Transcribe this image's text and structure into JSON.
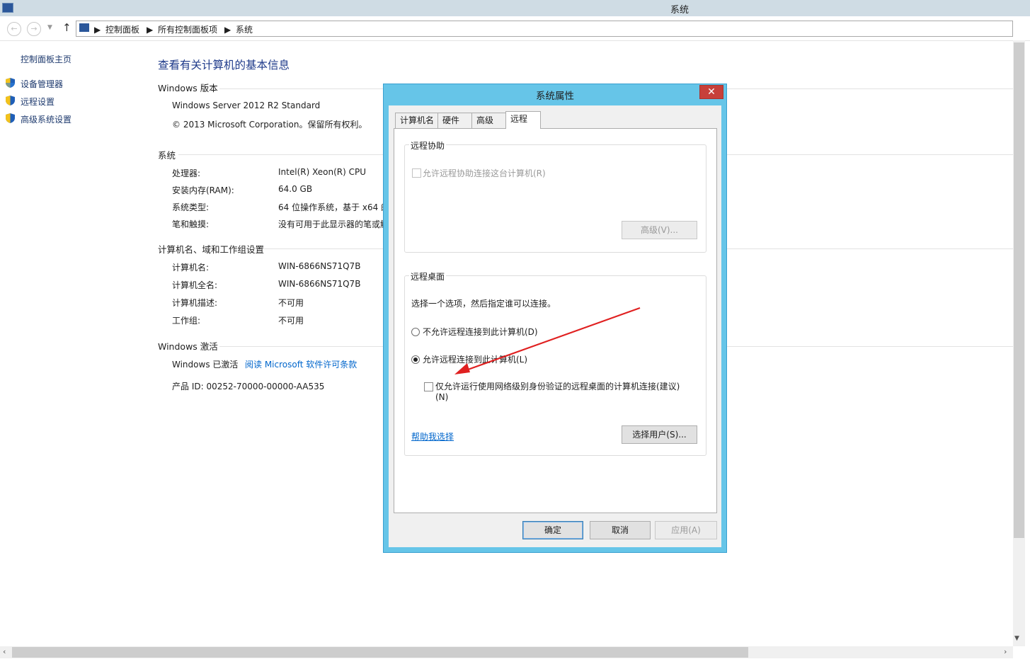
{
  "window": {
    "title": "系统"
  },
  "address": {
    "crumbs": [
      "控制面板",
      "所有控制面板项",
      "系统"
    ]
  },
  "sidebar": {
    "home": "控制面板主页",
    "links": [
      "设备管理器",
      "远程设置",
      "高级系统设置"
    ]
  },
  "main": {
    "heading": "查看有关计算机的基本信息",
    "windows_edition": {
      "title": "Windows 版本",
      "edition": "Windows Server 2012 R2 Standard",
      "copyright": "© 2013 Microsoft Corporation。保留所有权利。"
    },
    "system": {
      "title": "系统",
      "rows": [
        {
          "label": "处理器:",
          "value": "Intel(R) Xeon(R) CPU"
        },
        {
          "label": "安装内存(RAM):",
          "value": "64.0 GB"
        },
        {
          "label": "系统类型:",
          "value": "64 位操作系统，基于 x64 的"
        },
        {
          "label": "笔和触摸:",
          "value": "没有可用于此显示器的笔或触"
        }
      ]
    },
    "computer_name": {
      "title": "计算机名、域和工作组设置",
      "rows": [
        {
          "label": "计算机名:",
          "value": "WIN-6866NS71Q7B"
        },
        {
          "label": "计算机全名:",
          "value": "WIN-6866NS71Q7B"
        },
        {
          "label": "计算机描述:",
          "value": "不可用"
        },
        {
          "label": "工作组:",
          "value": "不可用"
        }
      ]
    },
    "activation": {
      "title": "Windows 激活",
      "status": "Windows 已激活",
      "license_link": "阅读 Microsoft 软件许可条款",
      "product_id": "产品 ID: 00252-70000-00000-AA535"
    }
  },
  "dialog": {
    "title": "系统属性",
    "close_label": "✕",
    "tabs": [
      "计算机名",
      "硬件",
      "高级",
      "远程"
    ],
    "remote_assistance": {
      "title": "远程协助",
      "allow_checkbox": "允许远程协助连接这台计算机(R)",
      "advanced_button": "高级(V)..."
    },
    "remote_desktop": {
      "title": "远程桌面",
      "instruction": "选择一个选项，然后指定谁可以连接。",
      "option_deny": "不允许远程连接到此计算机(D)",
      "option_allow": "允许远程连接到此计算机(L)",
      "nla_line1": "仅允许运行使用网络级别身份验证的远程桌面的计算机连接(建议)",
      "nla_line2": "(N)",
      "help_link": "帮助我选择",
      "select_users_button": "选择用户(S)..."
    },
    "buttons": {
      "ok": "确定",
      "cancel": "取消",
      "apply": "应用(A)"
    }
  },
  "colors": {
    "dialog_frame": "#66c5e8",
    "close_button": "#c7403a",
    "annotation_arrow": "#e02020"
  }
}
